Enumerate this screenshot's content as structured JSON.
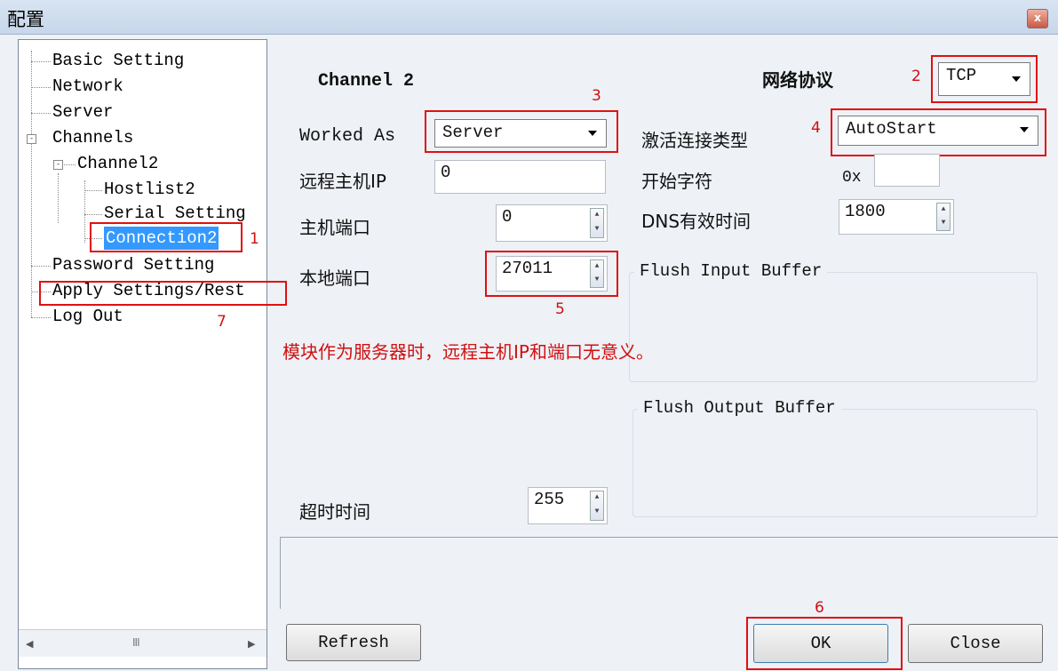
{
  "window": {
    "title": "配置",
    "close_glyph": "x"
  },
  "tree": {
    "items": [
      "Basic Setting",
      "Network",
      "Server",
      "Channels",
      "Channel2",
      "Hostlist2",
      "Serial Setting",
      "Connection2",
      "Password Setting",
      "Apply Settings/Rest",
      "Log Out"
    ],
    "expanders": [
      "-",
      "-"
    ],
    "scroll_left": "◀",
    "scroll_right": "▶",
    "scroll_thumb": "III"
  },
  "channel_title": "Channel 2",
  "protocol": {
    "label": "网络协议",
    "value": "TCP"
  },
  "worked_as": {
    "label": "Worked As",
    "value": "Server"
  },
  "activation": {
    "label": "激活连接类型",
    "value": "AutoStart"
  },
  "remote_ip": {
    "label": "远程主机IP",
    "value": "0"
  },
  "start_char": {
    "label": "开始字符",
    "prefix": "0x",
    "value": ""
  },
  "host_port": {
    "label": "主机端口",
    "value": "0"
  },
  "dns": {
    "label": "DNS有效时间",
    "value": "1800"
  },
  "local_port": {
    "label": "本地端口",
    "value": "27011"
  },
  "flush_input": "Flush Input Buffer",
  "flush_output": "Flush Output Buffer",
  "note": "模块作为服务器时，远程主机IP和端口无意义。",
  "timeout": {
    "label": "超时时间",
    "value": "255"
  },
  "buttons": {
    "refresh": "Refresh",
    "ok": "OK",
    "close": "Close"
  },
  "annotations": [
    "1",
    "2",
    "3",
    "4",
    "5",
    "6",
    "7"
  ],
  "colors": {
    "annotation": "#e01010",
    "selection": "#3399ff"
  }
}
